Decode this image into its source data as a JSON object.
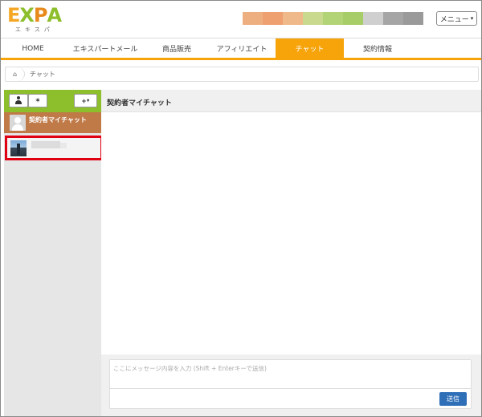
{
  "app": {
    "logo": {
      "letters": [
        {
          "char": "E",
          "color": "#f5a623"
        },
        {
          "char": "X",
          "color": "#8dbe2b"
        },
        {
          "char": "P",
          "color": "#e8891c"
        },
        {
          "char": "A",
          "color": "#8dbe2b"
        }
      ],
      "subtitle": "エキスパ"
    },
    "color_bar": [
      "#eeaf80",
      "#eea070",
      "#f0b98a",
      "#c9d98e",
      "#b2d477",
      "#a7cd68",
      "#cfcfcf",
      "#a5a5a5",
      "#9a9a9a"
    ],
    "menu_button": {
      "label": "メニュー",
      "caret": "▾"
    }
  },
  "nav": {
    "tabs": [
      {
        "label": "HOME",
        "active": false
      },
      {
        "label": "エキスパートメール",
        "active": false
      },
      {
        "label": "商品販売",
        "active": false
      },
      {
        "label": "アフィリエイト",
        "active": false
      },
      {
        "label": "チャット",
        "active": true
      },
      {
        "label": "契約情報",
        "active": false
      }
    ],
    "accent_color": "#f7a30a"
  },
  "breadcrumb": {
    "home_icon": "home-icon",
    "current": "チャット"
  },
  "sidebar": {
    "toolbar": {
      "user_icon": "user-icon",
      "group_icon": "people-icon",
      "add_label": "+",
      "add_caret": "▾",
      "toolbar_color": "#8dbe2b"
    },
    "chats": [
      {
        "name": "契約者マイチャット",
        "avatar": "default-avatar-icon",
        "selected": false,
        "bg_color": "#c07a48"
      },
      {
        "name": "",
        "avatar": "photo-avatar",
        "selected": true,
        "highlight_color": "#e00012"
      }
    ]
  },
  "chat": {
    "title": "契約者マイチャット",
    "input": {
      "placeholder": "ここにメッセージ内容を入力 (Shift + Enterキーで送信)",
      "value": ""
    },
    "send_label": "送信",
    "send_color": "#2f6fb8"
  }
}
